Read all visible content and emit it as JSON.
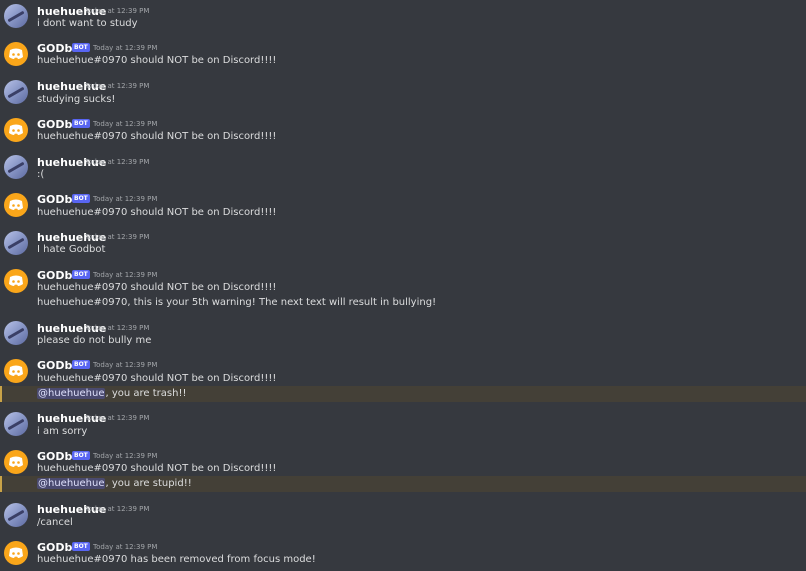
{
  "users": {
    "user_name": "huehuehue",
    "bot_name": "GODbot",
    "bot_badge": "BOT",
    "timestamp": "Today at 12:39 PM"
  },
  "messages": [
    {
      "author": "huehuehue",
      "time": "Today at 12:39 PM",
      "lines": [
        "i dont want to study"
      ]
    },
    {
      "author": "GODbot",
      "time": "Today at 12:39 PM",
      "lines": [
        "huehuehue#0970 should NOT be on Discord!!!!"
      ]
    },
    {
      "author": "huehuehue",
      "time": "Today at 12:39 PM",
      "lines": [
        "studying sucks!"
      ]
    },
    {
      "author": "GODbot",
      "time": "Today at 12:39 PM",
      "lines": [
        "huehuehue#0970 should NOT be on Discord!!!!"
      ]
    },
    {
      "author": "huehuehue",
      "time": "Today at 12:39 PM",
      "lines": [
        ":("
      ]
    },
    {
      "author": "GODbot",
      "time": "Today at 12:39 PM",
      "lines": [
        "huehuehue#0970 should NOT be on Discord!!!!"
      ]
    },
    {
      "author": "huehuehue",
      "time": "Today at 12:39 PM",
      "lines": [
        "I hate Godbot"
      ]
    },
    {
      "author": "GODbot",
      "time": "Today at 12:39 PM",
      "lines": [
        "huehuehue#0970 should NOT be on Discord!!!!",
        "huehuehue#0970, this is your 5th warning! The next text will result in bullying!"
      ]
    },
    {
      "author": "huehuehue",
      "time": "Today at 12:39 PM",
      "lines": [
        "please do not bully me"
      ]
    },
    {
      "author": "GODbot",
      "time": "Today at 12:39 PM",
      "lines": [
        "huehuehue#0970 should NOT be on Discord!!!!"
      ],
      "mention": "@huehuehue",
      "mention_rest": ", you are trash!!"
    },
    {
      "author": "huehuehue",
      "time": "Today at 12:39 PM",
      "lines": [
        "i am sorry"
      ]
    },
    {
      "author": "GODbot",
      "time": "Today at 12:39 PM",
      "lines": [
        "huehuehue#0970 should NOT be on Discord!!!!"
      ],
      "mention": "@huehuehue",
      "mention_rest": ", you are stupid!!"
    },
    {
      "author": "huehuehue",
      "time": "Today at 12:39 PM",
      "lines": [
        "/cancel"
      ]
    },
    {
      "author": "GODbot",
      "time": "Today at 12:39 PM",
      "lines": [
        "huehuehue#0970 has been removed from focus mode!"
      ]
    }
  ]
}
